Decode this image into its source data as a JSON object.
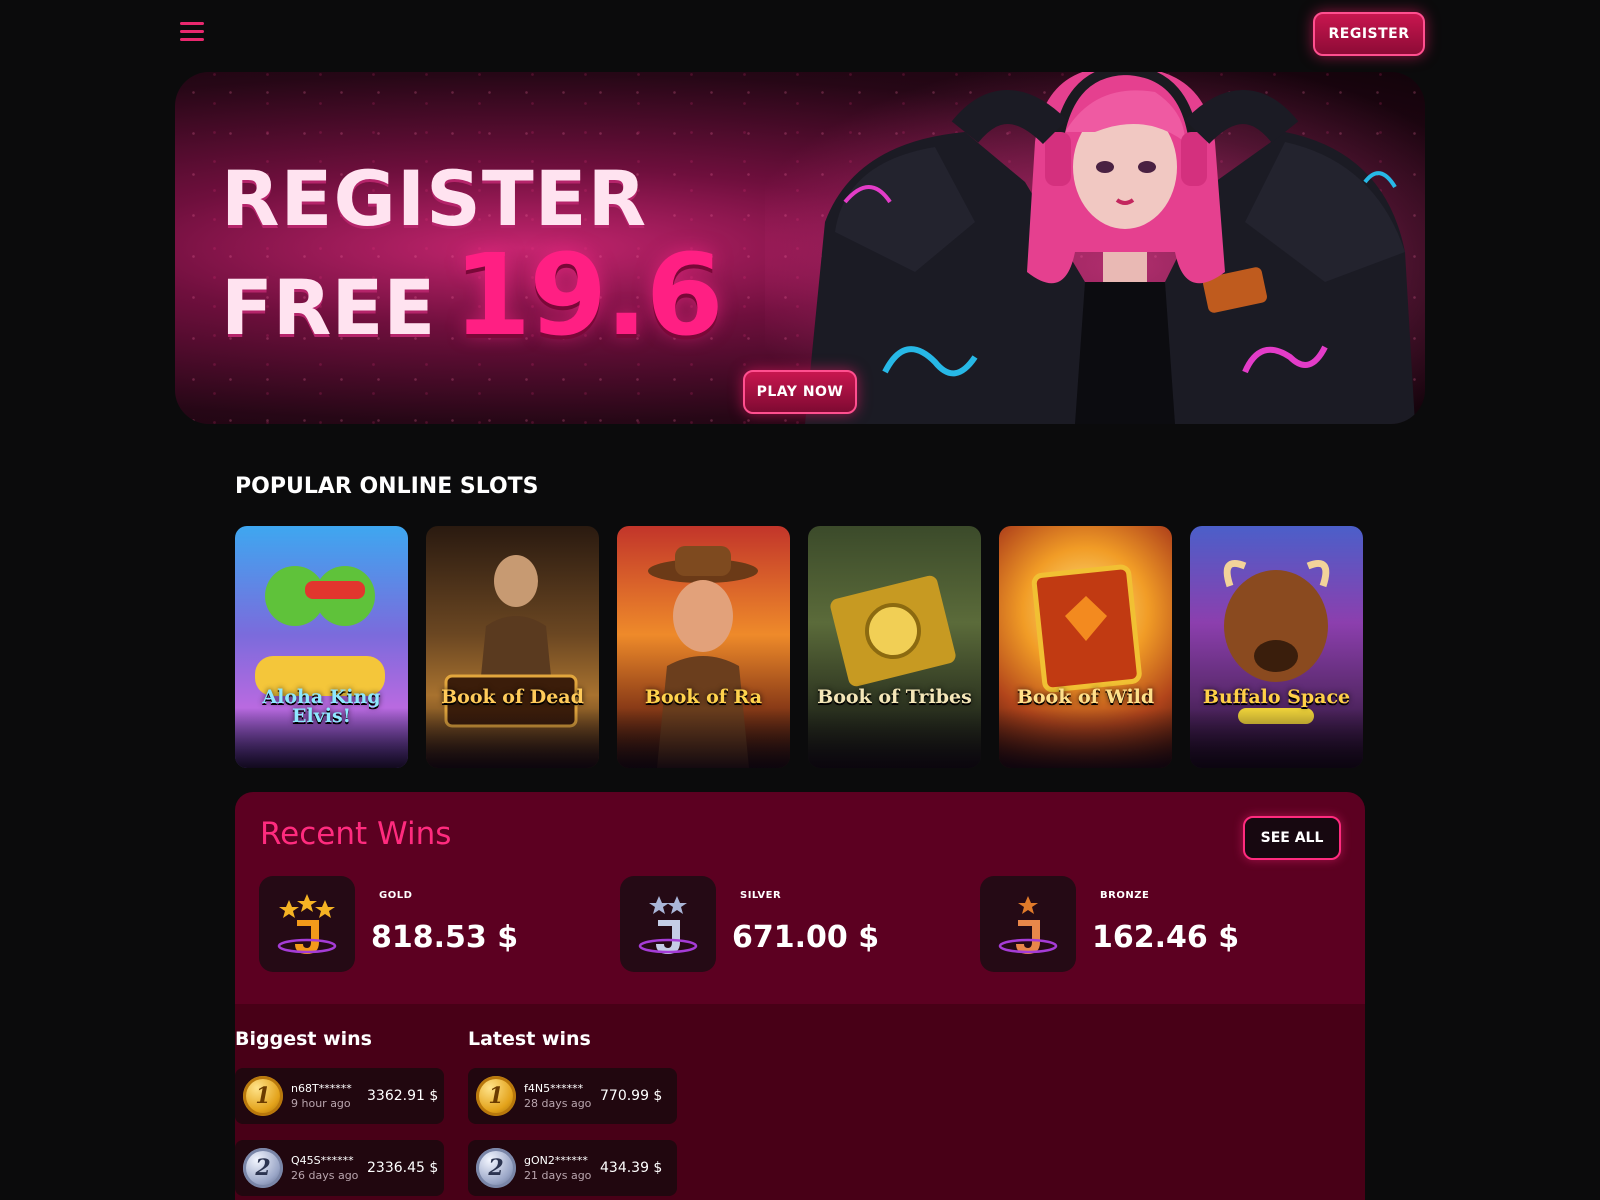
{
  "header": {
    "menu_icon": "hamburger-icon",
    "register_label": "REGISTER",
    "accent_color": "#e8286e"
  },
  "hero": {
    "line1": "REGISTER",
    "line2_prefix": "FREE",
    "amount": "19.6",
    "cta_label": "PLAY NOW"
  },
  "slots_section": {
    "title": "POPULAR ONLINE SLOTS",
    "items": [
      {
        "title": "Aloha King Elvis!"
      },
      {
        "title": "Book of Dead"
      },
      {
        "title": "Book of Ra"
      },
      {
        "title": "Book of Tribes"
      },
      {
        "title": "Book of Wild"
      },
      {
        "title": "Buffalo Space"
      }
    ]
  },
  "recent_wins": {
    "title": "Recent Wins",
    "see_all_label": "SEE ALL",
    "tiers": [
      {
        "label": "GOLD",
        "value": "818.53 $",
        "color": "#f5b324"
      },
      {
        "label": "SILVER",
        "value": "671.00 $",
        "color": "#aab6d8"
      },
      {
        "label": "BRONZE",
        "value": "162.46 $",
        "color": "#e07a2a"
      }
    ],
    "biggest": {
      "title": "Biggest wins",
      "rows": [
        {
          "rank": "1",
          "name": "n68T******",
          "time": "9 hour ago",
          "amount": "3362.91 $"
        },
        {
          "rank": "2",
          "name": "Q45S******",
          "time": "26 days ago",
          "amount": "2336.45 $"
        }
      ]
    },
    "latest": {
      "title": "Latest wins",
      "rows": [
        {
          "rank": "1",
          "name": "f4N5******",
          "time": "28 days ago",
          "amount": "770.99 $"
        },
        {
          "rank": "2",
          "name": "gON2******",
          "time": "21 days ago",
          "amount": "434.39 $"
        }
      ]
    }
  }
}
